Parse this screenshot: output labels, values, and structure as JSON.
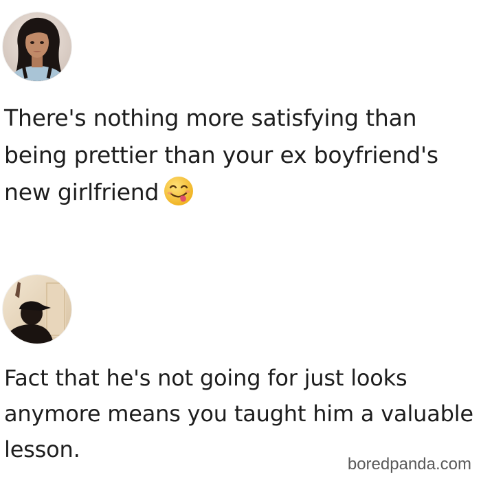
{
  "posts": [
    {
      "text": "There's nothing more satisfying than being prettier than your ex boyfriend's new girlfriend",
      "emoji": "face-savoring-food-icon"
    },
    {
      "text": "Fact that he's not going for just looks anymore means you taught him a valuable lesson."
    }
  ],
  "watermark": "boredpanda.com",
  "colors": {
    "background": "#ffffff",
    "text": "#1d1d1d",
    "watermark": "#5a5a5a",
    "emoji_face": "#f7c531"
  }
}
